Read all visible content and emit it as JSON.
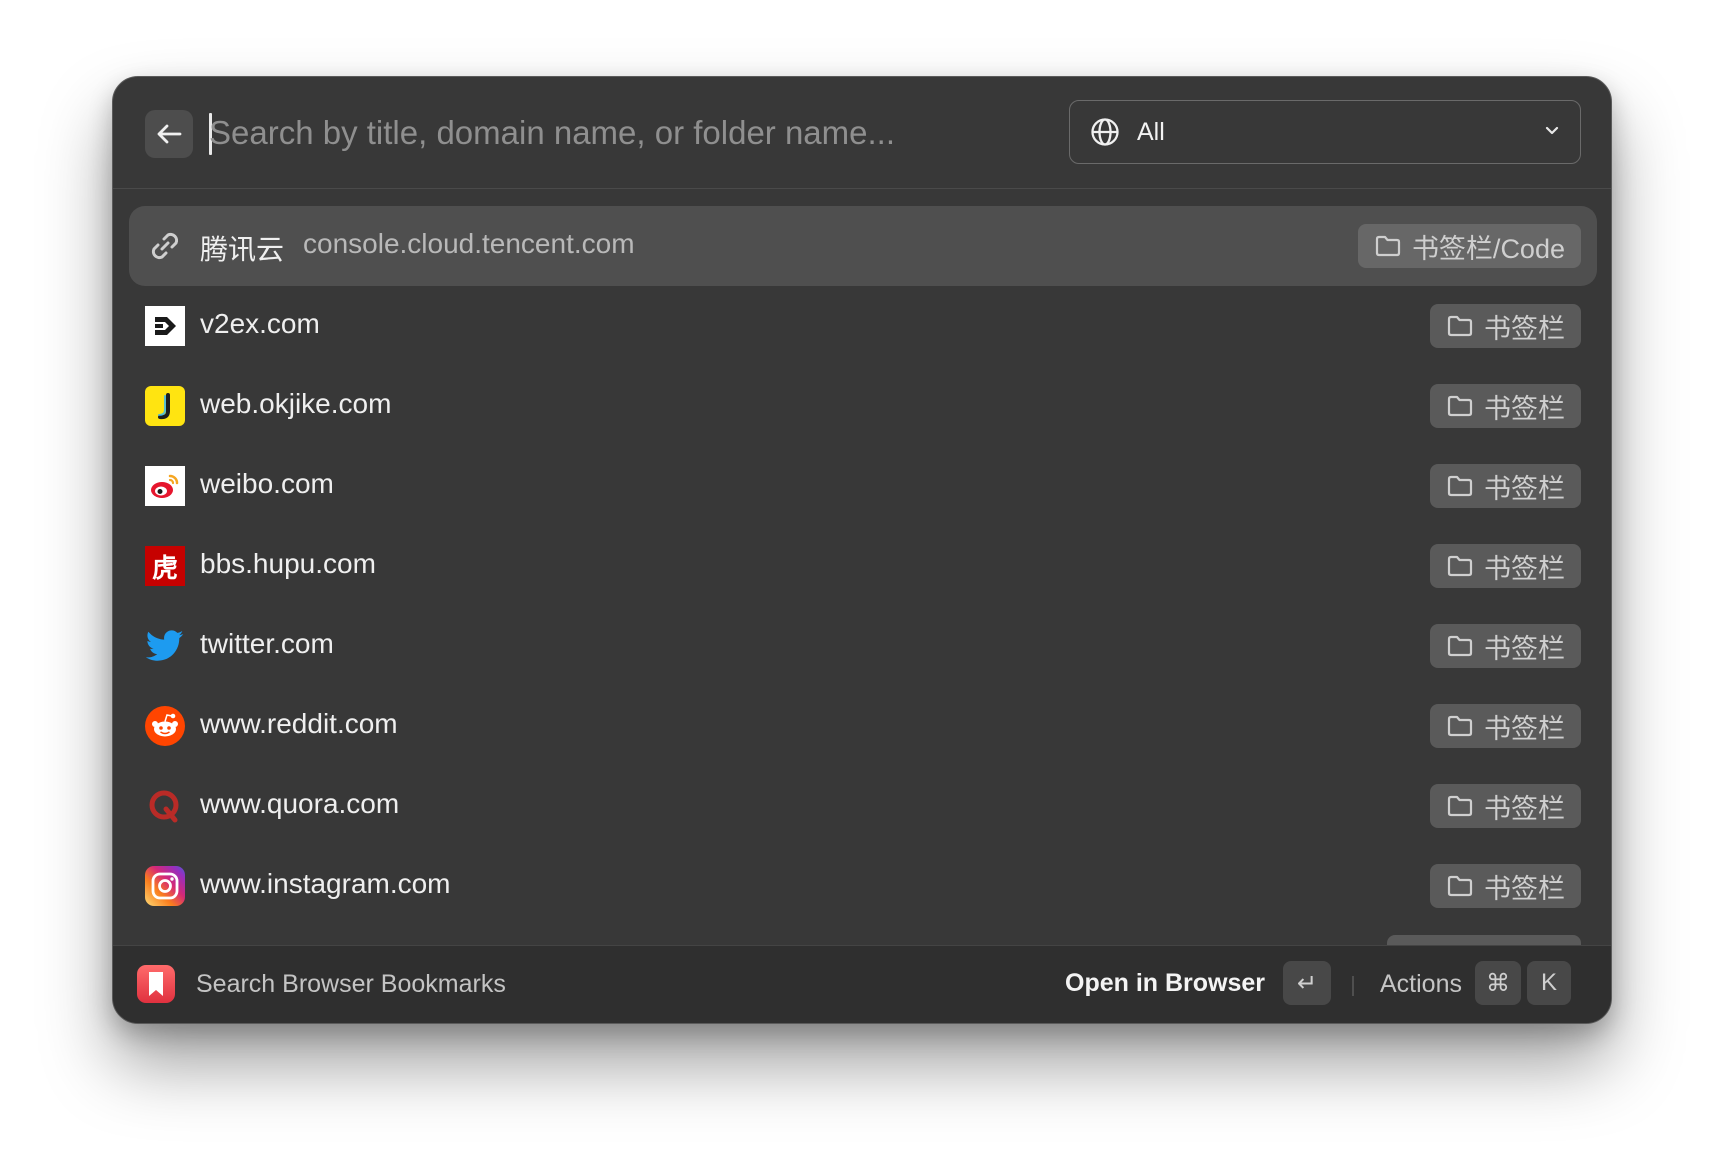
{
  "search": {
    "placeholder": "Search by title, domain name, or folder name...",
    "value": ""
  },
  "filter": {
    "selected": "All",
    "icon": "globe-icon"
  },
  "bookmarks": [
    {
      "title": "腾讯云",
      "domain": "console.cloud.tencent.com",
      "folder": "书签栏/Code",
      "icon": "link-icon",
      "selected": true
    },
    {
      "title": "v2ex.com",
      "domain": "",
      "folder": "书签栏",
      "icon": "v2ex-favicon"
    },
    {
      "title": "web.okjike.com",
      "domain": "",
      "folder": "书签栏",
      "icon": "jike-favicon"
    },
    {
      "title": "weibo.com",
      "domain": "",
      "folder": "书签栏",
      "icon": "weibo-favicon"
    },
    {
      "title": "bbs.hupu.com",
      "domain": "",
      "folder": "书签栏",
      "icon": "hupu-favicon"
    },
    {
      "title": "twitter.com",
      "domain": "",
      "folder": "书签栏",
      "icon": "twitter-favicon"
    },
    {
      "title": "www.reddit.com",
      "domain": "",
      "folder": "书签栏",
      "icon": "reddit-favicon"
    },
    {
      "title": "www.quora.com",
      "domain": "",
      "folder": "书签栏",
      "icon": "quora-favicon"
    },
    {
      "title": "www.instagram.com",
      "domain": "",
      "folder": "书签栏",
      "icon": "instagram-favicon"
    }
  ],
  "footer": {
    "app_name": "Search Browser Bookmarks",
    "primary_action": "Open in Browser",
    "primary_key": "↵",
    "actions_label": "Actions",
    "actions_keys": [
      "⌘",
      "K"
    ]
  },
  "hupu_glyph": "虎",
  "colors": {
    "window_bg": "#383838",
    "selected_row": "#4f4f4f",
    "tag_bg": "#5a5a5a",
    "footer_bg": "#2f2f2f"
  }
}
